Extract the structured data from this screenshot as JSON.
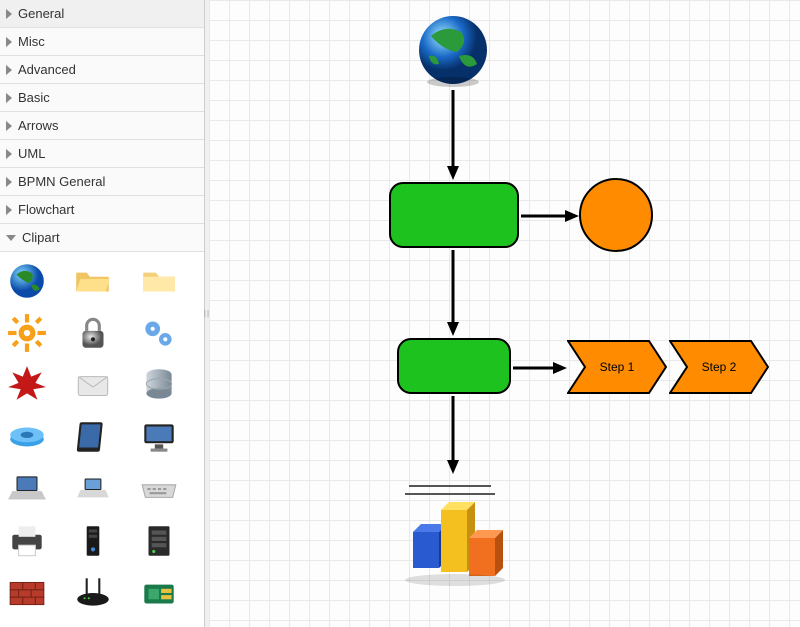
{
  "sidebar": {
    "categories": [
      {
        "label": "General",
        "expanded": false
      },
      {
        "label": "Misc",
        "expanded": false
      },
      {
        "label": "Advanced",
        "expanded": false
      },
      {
        "label": "Basic",
        "expanded": false
      },
      {
        "label": "Arrows",
        "expanded": false
      },
      {
        "label": "UML",
        "expanded": false
      },
      {
        "label": "BPMN General",
        "expanded": false
      },
      {
        "label": "Flowchart",
        "expanded": false
      },
      {
        "label": "Clipart",
        "expanded": true
      }
    ],
    "clipart": [
      "globe",
      "folder-open",
      "folder",
      "gear",
      "lock",
      "gears-blue",
      "starburst",
      "envelope",
      "database",
      "network-disc",
      "tablet",
      "monitor",
      "laptop",
      "laptop-small",
      "keyboard",
      "printer",
      "tower",
      "server",
      "firewall",
      "router",
      "drive-card"
    ]
  },
  "canvas": {
    "step1_label": "Step 1",
    "step2_label": "Step 2",
    "colors": {
      "green": "#1ec21e",
      "orange": "#ff8c00",
      "black": "#000000"
    }
  }
}
